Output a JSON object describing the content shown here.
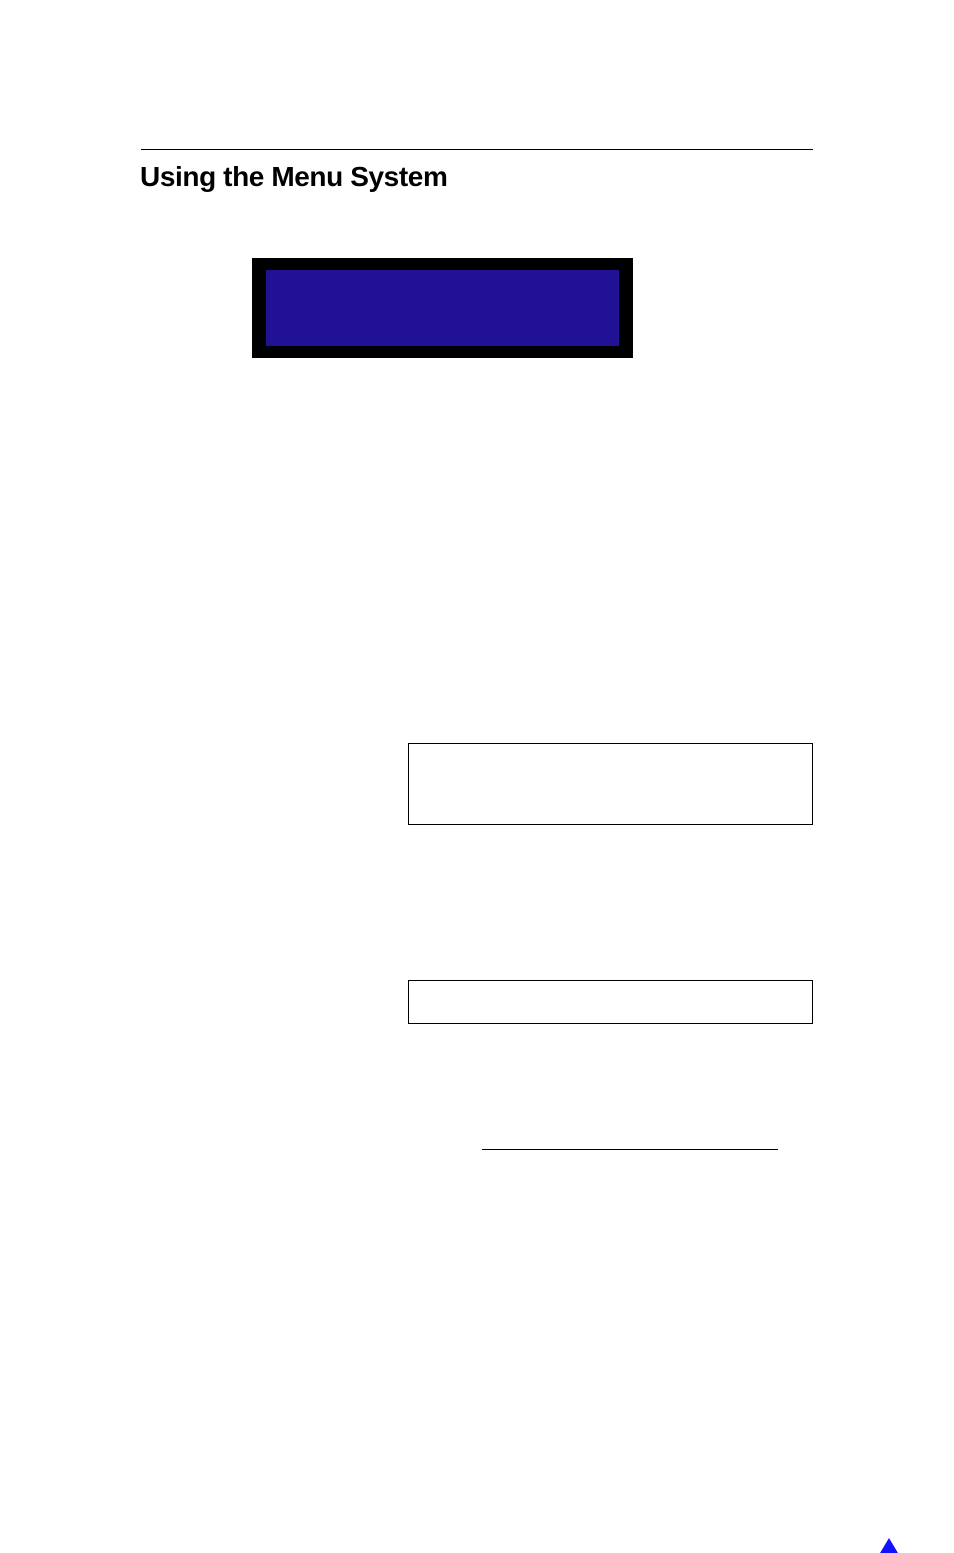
{
  "title": "Using the Menu System",
  "icon_name": "up-triangle-icon"
}
